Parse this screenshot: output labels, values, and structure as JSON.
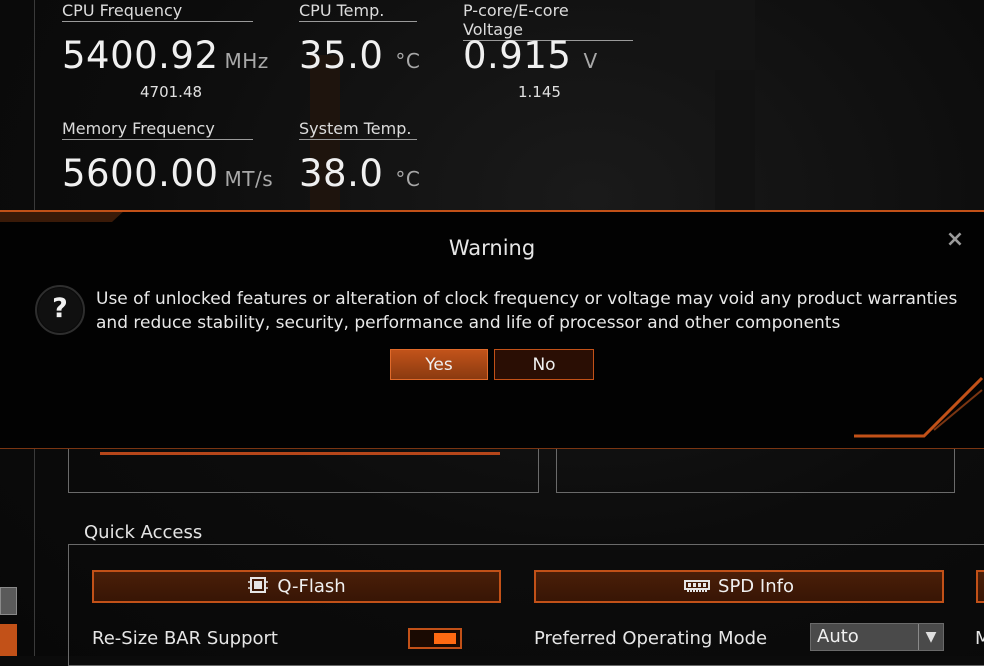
{
  "stats": {
    "cpu_freq": {
      "label": "CPU Frequency",
      "value": "5400.92",
      "unit": "MHz",
      "sub": "4701.48"
    },
    "cpu_temp": {
      "label": "CPU Temp.",
      "value": "35.0",
      "unit": "°C"
    },
    "voltage": {
      "label": "P-core/E-core Voltage",
      "value": "0.915",
      "unit": "V",
      "sub": "1.145"
    },
    "mem_freq": {
      "label": "Memory Frequency",
      "value": "5600.00",
      "unit": "MT/s"
    },
    "sys_temp": {
      "label": "System Temp.",
      "value": "38.0",
      "unit": "°C"
    }
  },
  "dialog": {
    "title": "Warning",
    "close_icon": "×",
    "question_icon": "?",
    "message_line1": "Use of unlocked features or alteration of clock frequency or voltage may void any product warranties",
    "message_line2": "and reduce stability, security, performance and life of processor and other components",
    "yes_label": "Yes",
    "no_label": "No"
  },
  "quick_access": {
    "title": "Quick Access",
    "qflash_label": "Q-Flash",
    "qflash_icon": "chip-icon",
    "spd_label": "SPD Info",
    "spd_icon": "memory-icon",
    "resize_bar_label": "Re-Size BAR Support",
    "resize_bar_enabled": true,
    "preferred_mode_label": "Preferred Operating Mode",
    "preferred_mode_value": "Auto",
    "right_cut_label": "M"
  },
  "colors": {
    "accent": "#c25118",
    "accent_bright": "#ff6a12",
    "background": "#0b0b0b"
  }
}
